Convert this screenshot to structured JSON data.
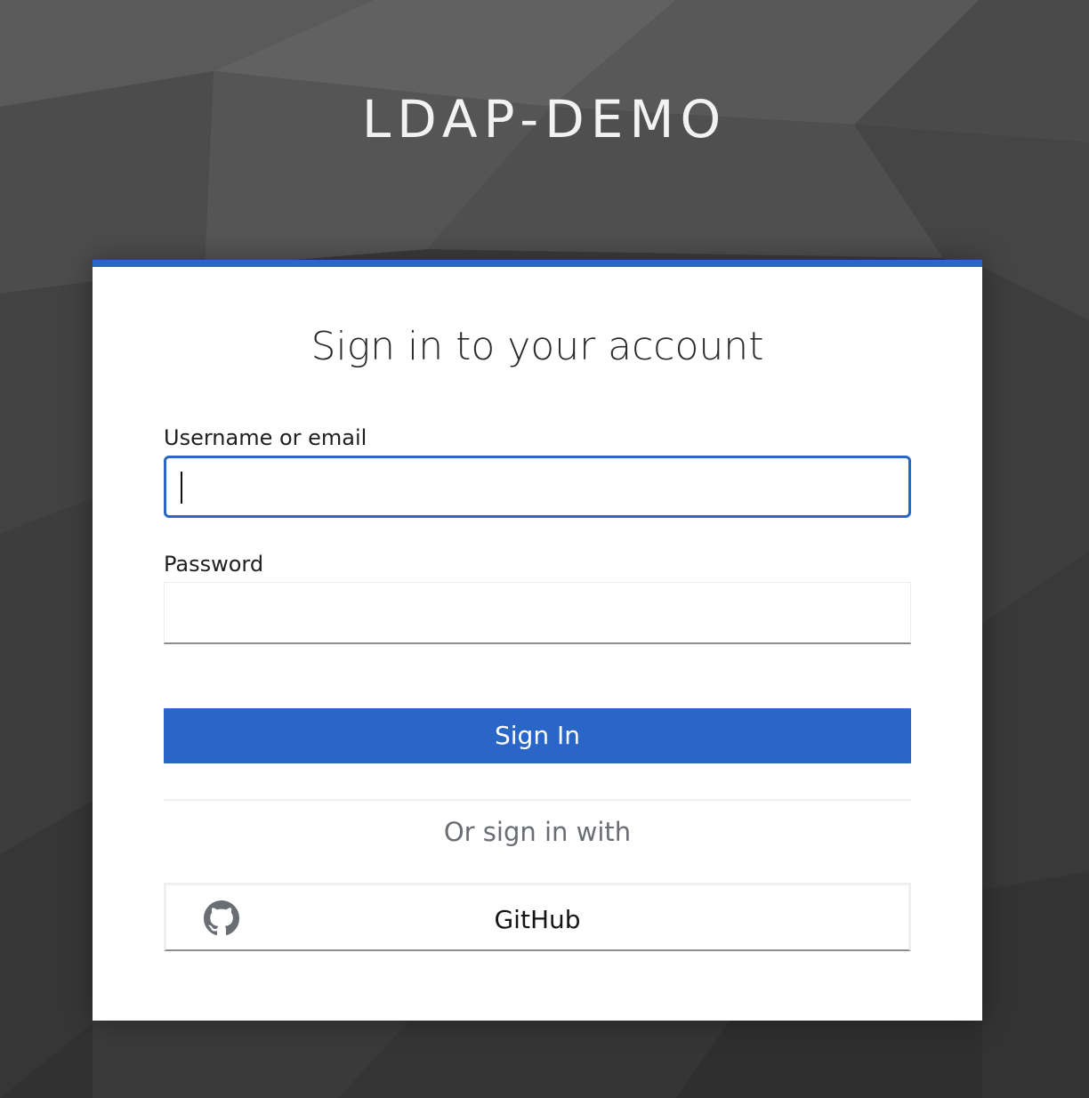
{
  "realm": {
    "title": "LDAP-DEMO"
  },
  "login": {
    "heading": "Sign in to your account",
    "username": {
      "label": "Username or email",
      "value": ""
    },
    "password": {
      "label": "Password",
      "value": ""
    },
    "submit_label": "Sign In",
    "alternative_text": "Or sign in with",
    "providers": [
      {
        "label": "GitHub",
        "icon": "github-icon"
      }
    ]
  },
  "colors": {
    "accent": "#2a65c8",
    "background": "#3a3a3a",
    "card": "#ffffff"
  }
}
